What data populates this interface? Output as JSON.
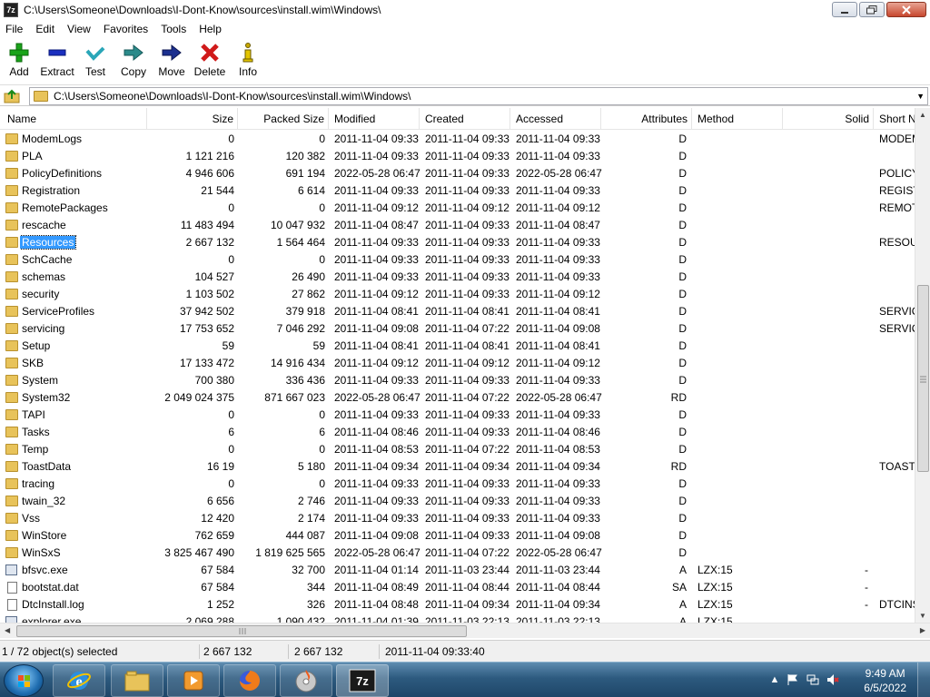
{
  "window": {
    "app_icon_label": "7z",
    "title": "C:\\Users\\Someone\\Downloads\\I-Dont-Know\\sources\\install.wim\\Windows\\"
  },
  "menu": [
    "File",
    "Edit",
    "View",
    "Favorites",
    "Tools",
    "Help"
  ],
  "toolbar": [
    {
      "name": "add",
      "label": "Add",
      "icon": "plus-icon",
      "color": "#1aa31a"
    },
    {
      "name": "extract",
      "label": "Extract",
      "icon": "minus-icon",
      "color": "#1a2fbf"
    },
    {
      "name": "test",
      "label": "Test",
      "icon": "check-icon",
      "color": "#2aa6b8"
    },
    {
      "name": "copy",
      "label": "Copy",
      "icon": "arrow-right-icon",
      "color": "#2b8a8a"
    },
    {
      "name": "move",
      "label": "Move",
      "icon": "arrow-right-icon",
      "color": "#1b2f8f"
    },
    {
      "name": "delete",
      "label": "Delete",
      "icon": "x-icon",
      "color": "#d01a1a"
    },
    {
      "name": "info",
      "label": "Info",
      "icon": "info-icon",
      "color": "#c8a800"
    }
  ],
  "address": {
    "path": "C:\\Users\\Someone\\Downloads\\I-Dont-Know\\sources\\install.wim\\Windows\\"
  },
  "columns": [
    "Name",
    "Size",
    "Packed Size",
    "Modified",
    "Created",
    "Accessed",
    "Attributes",
    "Method",
    "Solid",
    "Short N"
  ],
  "rows": [
    {
      "type": "folder",
      "name": "ModemLogs",
      "size": "0",
      "packed": "0",
      "modified": "2011-11-04 09:33",
      "created": "2011-11-04 09:33",
      "accessed": "2011-11-04 09:33",
      "attr": "D",
      "method": "",
      "solid": "",
      "short": "MODEM"
    },
    {
      "type": "folder",
      "name": "PLA",
      "size": "1 121 216",
      "packed": "120 382",
      "modified": "2011-11-04 09:33",
      "created": "2011-11-04 09:33",
      "accessed": "2011-11-04 09:33",
      "attr": "D",
      "method": "",
      "solid": "",
      "short": ""
    },
    {
      "type": "folder",
      "name": "PolicyDefinitions",
      "size": "4 946 606",
      "packed": "691 194",
      "modified": "2022-05-28 06:47",
      "created": "2011-11-04 09:33",
      "accessed": "2022-05-28 06:47",
      "attr": "D",
      "method": "",
      "solid": "",
      "short": "POLICY"
    },
    {
      "type": "folder",
      "name": "Registration",
      "size": "21 544",
      "packed": "6 614",
      "modified": "2011-11-04 09:33",
      "created": "2011-11-04 09:33",
      "accessed": "2011-11-04 09:33",
      "attr": "D",
      "method": "",
      "solid": "",
      "short": "REGIST"
    },
    {
      "type": "folder",
      "name": "RemotePackages",
      "size": "0",
      "packed": "0",
      "modified": "2011-11-04 09:12",
      "created": "2011-11-04 09:12",
      "accessed": "2011-11-04 09:12",
      "attr": "D",
      "method": "",
      "solid": "",
      "short": "REMOT"
    },
    {
      "type": "folder",
      "name": "rescache",
      "size": "11 483 494",
      "packed": "10 047 932",
      "modified": "2011-11-04 08:47",
      "created": "2011-11-04 09:33",
      "accessed": "2011-11-04 08:47",
      "attr": "D",
      "method": "",
      "solid": "",
      "short": ""
    },
    {
      "type": "folder",
      "name": "Resources",
      "size": "2 667 132",
      "packed": "1 564 464",
      "modified": "2011-11-04 09:33",
      "created": "2011-11-04 09:33",
      "accessed": "2011-11-04 09:33",
      "attr": "D",
      "method": "",
      "solid": "",
      "short": "RESOU",
      "selected": true
    },
    {
      "type": "folder",
      "name": "SchCache",
      "size": "0",
      "packed": "0",
      "modified": "2011-11-04 09:33",
      "created": "2011-11-04 09:33",
      "accessed": "2011-11-04 09:33",
      "attr": "D",
      "method": "",
      "solid": "",
      "short": ""
    },
    {
      "type": "folder",
      "name": "schemas",
      "size": "104 527",
      "packed": "26 490",
      "modified": "2011-11-04 09:33",
      "created": "2011-11-04 09:33",
      "accessed": "2011-11-04 09:33",
      "attr": "D",
      "method": "",
      "solid": "",
      "short": ""
    },
    {
      "type": "folder",
      "name": "security",
      "size": "1 103 502",
      "packed": "27 862",
      "modified": "2011-11-04 09:12",
      "created": "2011-11-04 09:33",
      "accessed": "2011-11-04 09:12",
      "attr": "D",
      "method": "",
      "solid": "",
      "short": ""
    },
    {
      "type": "folder",
      "name": "ServiceProfiles",
      "size": "37 942 502",
      "packed": "379 918",
      "modified": "2011-11-04 08:41",
      "created": "2011-11-04 08:41",
      "accessed": "2011-11-04 08:41",
      "attr": "D",
      "method": "",
      "solid": "",
      "short": "SERVIC"
    },
    {
      "type": "folder",
      "name": "servicing",
      "size": "17 753 652",
      "packed": "7 046 292",
      "modified": "2011-11-04 09:08",
      "created": "2011-11-04 07:22",
      "accessed": "2011-11-04 09:08",
      "attr": "D",
      "method": "",
      "solid": "",
      "short": "SERVIC"
    },
    {
      "type": "folder",
      "name": "Setup",
      "size": "59",
      "packed": "59",
      "modified": "2011-11-04 08:41",
      "created": "2011-11-04 08:41",
      "accessed": "2011-11-04 08:41",
      "attr": "D",
      "method": "",
      "solid": "",
      "short": ""
    },
    {
      "type": "folder",
      "name": "SKB",
      "size": "17 133 472",
      "packed": "14 916 434",
      "modified": "2011-11-04 09:12",
      "created": "2011-11-04 09:12",
      "accessed": "2011-11-04 09:12",
      "attr": "D",
      "method": "",
      "solid": "",
      "short": ""
    },
    {
      "type": "folder",
      "name": "System",
      "size": "700 380",
      "packed": "336 436",
      "modified": "2011-11-04 09:33",
      "created": "2011-11-04 09:33",
      "accessed": "2011-11-04 09:33",
      "attr": "D",
      "method": "",
      "solid": "",
      "short": ""
    },
    {
      "type": "folder",
      "name": "System32",
      "size": "2 049 024 375",
      "packed": "871 667 023",
      "modified": "2022-05-28 06:47",
      "created": "2011-11-04 07:22",
      "accessed": "2022-05-28 06:47",
      "attr": "RD",
      "method": "",
      "solid": "",
      "short": ""
    },
    {
      "type": "folder",
      "name": "TAPI",
      "size": "0",
      "packed": "0",
      "modified": "2011-11-04 09:33",
      "created": "2011-11-04 09:33",
      "accessed": "2011-11-04 09:33",
      "attr": "D",
      "method": "",
      "solid": "",
      "short": ""
    },
    {
      "type": "folder",
      "name": "Tasks",
      "size": "6",
      "packed": "6",
      "modified": "2011-11-04 08:46",
      "created": "2011-11-04 09:33",
      "accessed": "2011-11-04 08:46",
      "attr": "D",
      "method": "",
      "solid": "",
      "short": ""
    },
    {
      "type": "folder",
      "name": "Temp",
      "size": "0",
      "packed": "0",
      "modified": "2011-11-04 08:53",
      "created": "2011-11-04 07:22",
      "accessed": "2011-11-04 08:53",
      "attr": "D",
      "method": "",
      "solid": "",
      "short": ""
    },
    {
      "type": "folder",
      "name": "ToastData",
      "size": "16 19",
      "packed": "5 180",
      "modified": "2011-11-04 09:34",
      "created": "2011-11-04 09:34",
      "accessed": "2011-11-04 09:34",
      "attr": "RD",
      "method": "",
      "solid": "",
      "short": "TOAST"
    },
    {
      "type": "folder",
      "name": "tracing",
      "size": "0",
      "packed": "0",
      "modified": "2011-11-04 09:33",
      "created": "2011-11-04 09:33",
      "accessed": "2011-11-04 09:33",
      "attr": "D",
      "method": "",
      "solid": "",
      "short": ""
    },
    {
      "type": "folder",
      "name": "twain_32",
      "size": "6 656",
      "packed": "2 746",
      "modified": "2011-11-04 09:33",
      "created": "2011-11-04 09:33",
      "accessed": "2011-11-04 09:33",
      "attr": "D",
      "method": "",
      "solid": "",
      "short": ""
    },
    {
      "type": "folder",
      "name": "Vss",
      "size": "12 420",
      "packed": "2 174",
      "modified": "2011-11-04 09:33",
      "created": "2011-11-04 09:33",
      "accessed": "2011-11-04 09:33",
      "attr": "D",
      "method": "",
      "solid": "",
      "short": ""
    },
    {
      "type": "folder",
      "name": "WinStore",
      "size": "762 659",
      "packed": "444 087",
      "modified": "2011-11-04 09:08",
      "created": "2011-11-04 09:33",
      "accessed": "2011-11-04 09:08",
      "attr": "D",
      "method": "",
      "solid": "",
      "short": ""
    },
    {
      "type": "folder",
      "name": "WinSxS",
      "size": "3 825 467 490",
      "packed": "1 819 625 565",
      "modified": "2022-05-28 06:47",
      "created": "2011-11-04 07:22",
      "accessed": "2022-05-28 06:47",
      "attr": "D",
      "method": "",
      "solid": "",
      "short": ""
    },
    {
      "type": "exe",
      "name": "bfsvc.exe",
      "size": "67 584",
      "packed": "32 700",
      "modified": "2011-11-04 01:14",
      "created": "2011-11-03 23:44",
      "accessed": "2011-11-03 23:44",
      "attr": "A",
      "method": "LZX:15",
      "solid": "-",
      "short": ""
    },
    {
      "type": "file",
      "name": "bootstat.dat",
      "size": "67 584",
      "packed": "344",
      "modified": "2011-11-04 08:49",
      "created": "2011-11-04 08:44",
      "accessed": "2011-11-04 08:44",
      "attr": "SA",
      "method": "LZX:15",
      "solid": "-",
      "short": ""
    },
    {
      "type": "file",
      "name": "DtcInstall.log",
      "size": "1 252",
      "packed": "326",
      "modified": "2011-11-04 08:48",
      "created": "2011-11-04 09:34",
      "accessed": "2011-11-04 09:34",
      "attr": "A",
      "method": "LZX:15",
      "solid": "-",
      "short": "DTCINS"
    },
    {
      "type": "exe",
      "name": "explorer.exe",
      "size": "2 069 288",
      "packed": "1 090 432",
      "modified": "2011-11-04 01:39",
      "created": "2011-11-03 22:13",
      "accessed": "2011-11-03 22:13",
      "attr": "A",
      "method": "LZX:15",
      "solid": "",
      "short": ""
    }
  ],
  "status": {
    "selection": "1 / 72 object(s) selected",
    "size": "2 667 132",
    "packed": "2 667 132",
    "modified": "2011-11-04 09:33:40"
  },
  "taskbar": {
    "apps": [
      "internet-explorer-icon",
      "file-explorer-icon",
      "media-player-icon",
      "firefox-icon",
      "burn-disc-icon",
      "7zip-icon"
    ],
    "time": "9:49 AM",
    "date": "6/5/2022"
  }
}
